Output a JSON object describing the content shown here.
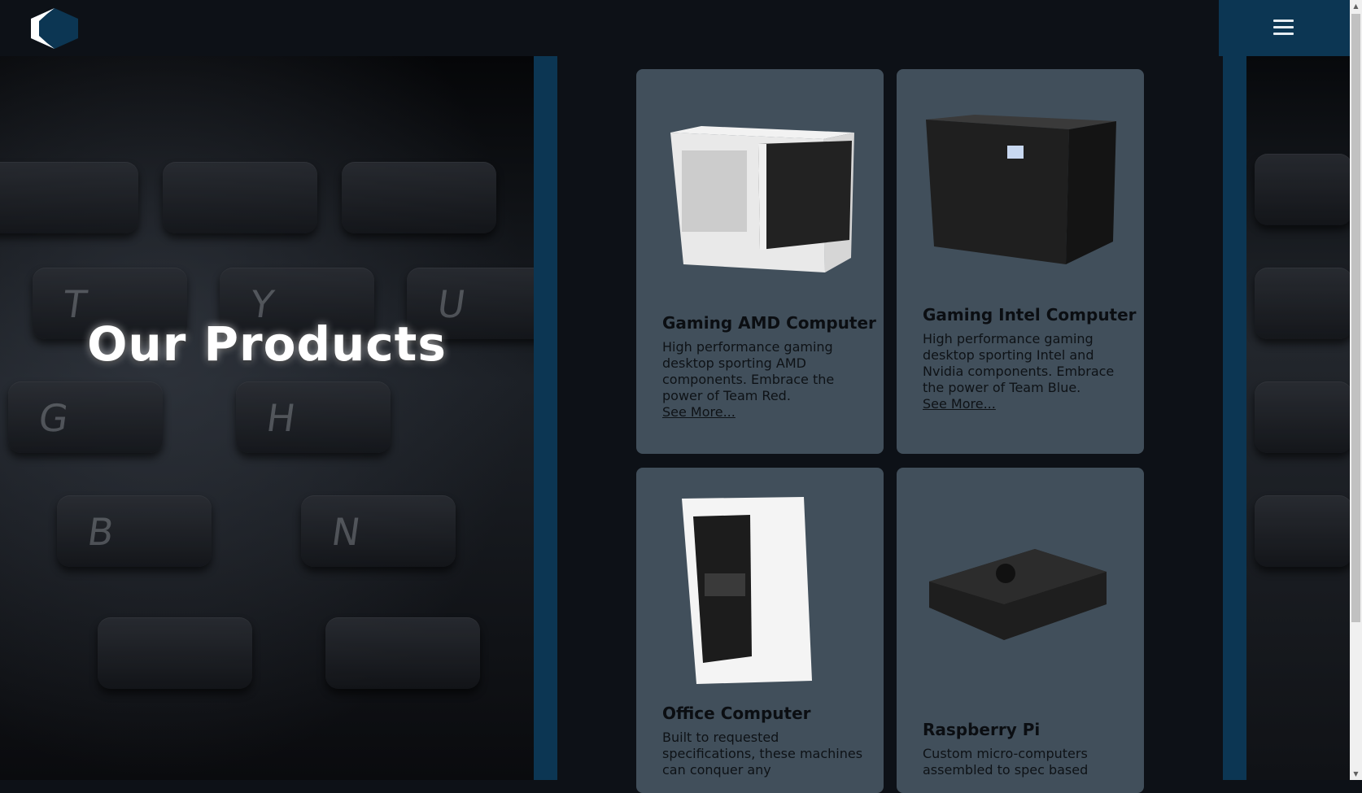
{
  "header": {
    "logo_alt": "hexagon-logo",
    "menu_icon": "hamburger-menu-icon"
  },
  "hero": {
    "title": "Our Products",
    "keys": [
      "T",
      "Y",
      "U",
      "G",
      "H",
      "B",
      "N"
    ]
  },
  "products": [
    {
      "title": "Gaming AMD Computer",
      "description": "High performance gaming desktop sporting AMD components. Embrace the power of Team Red.",
      "link": "See More..."
    },
    {
      "title": "Gaming Intel Computer",
      "description": "High performance gaming desktop sporting Intel and Nvidia components. Embrace the power of Team Blue.",
      "link": "See More..."
    },
    {
      "title": "Office Computer",
      "description": "Built to requested specifications, these machines can conquer any"
    },
    {
      "title": "Raspberry Pi",
      "description": "Custom micro-computers assembled to spec based"
    }
  ],
  "colors": {
    "accent": "#0c3653",
    "card": "#414f5b",
    "page": "#0d1117"
  }
}
